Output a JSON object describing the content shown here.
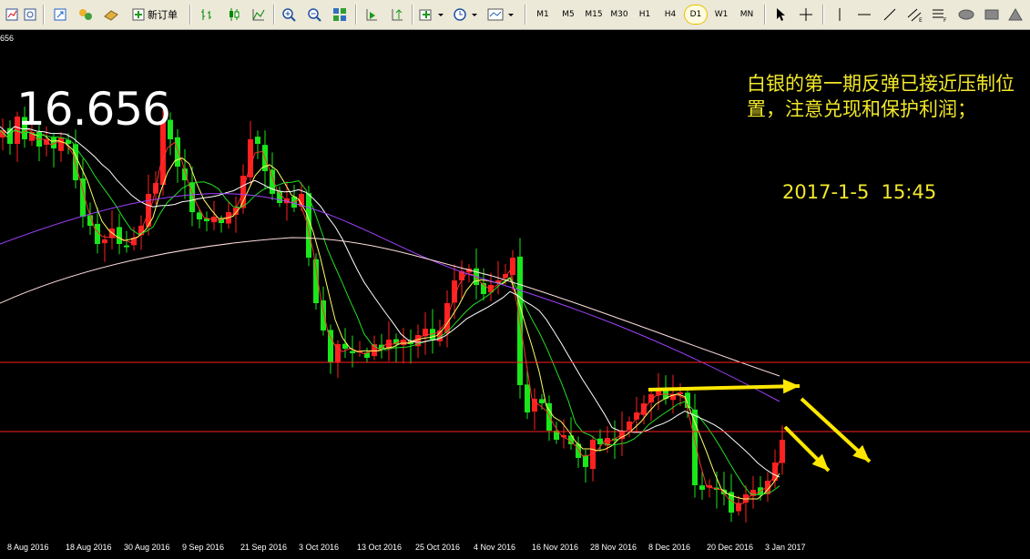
{
  "toolbar": {
    "new_order_label": "新订单",
    "timeframes": [
      "M1",
      "M5",
      "M15",
      "M30",
      "H1",
      "H4",
      "D1",
      "W1",
      "MN"
    ],
    "active_timeframe": "D1",
    "icons": [
      "new-chart-icon",
      "profiles-icon",
      "zoom-window-icon",
      "market-watch-icon",
      "navigator-icon",
      "bar-chart-icon",
      "candlestick-icon",
      "line-chart-icon",
      "zoom-in-icon",
      "zoom-out-icon",
      "tile-windows-icon",
      "autoscroll-icon",
      "chart-shift-icon",
      "indicators-icon",
      "periods-icon",
      "templates-icon",
      "cursor-icon",
      "crosshair-icon",
      "vertical-line-icon",
      "horizontal-line-icon",
      "trendline-icon",
      "fibonacci-icon",
      "text-label-icon",
      "ellipse-icon",
      "rectangle-icon"
    ]
  },
  "chart": {
    "corner_price": "656",
    "current_price": "16.656",
    "note": "白银的第一期反弹已接近压制位置，注意兑现和保护利润；",
    "note_date": "2017-1-5  15:45",
    "x_labels": [
      "8 Aug 2016",
      "18 Aug 2016",
      "30 Aug 2016",
      "9 Sep 2016",
      "21 Sep 2016",
      "3 Oct 2016",
      "13 Oct 2016",
      "25 Oct 2016",
      "4 Nov 2016",
      "16 Nov 2016",
      "28 Nov 2016",
      "8 Dec 2016",
      "20 Dec 2016",
      "3 Jan 2017"
    ],
    "colors": {
      "background": "#000000",
      "bull": "#FF2020",
      "bear": "#1AE61A",
      "ma_fast": "#FF3030",
      "ma_yellow": "#FFFF66",
      "ma_green": "#22DD22",
      "ma_white": "#FFFFFF",
      "ma_purple": "#A040FF",
      "ma_pink": "#FFDDDD",
      "hline": "#FF2020",
      "arrow": "#FFE800"
    }
  }
}
